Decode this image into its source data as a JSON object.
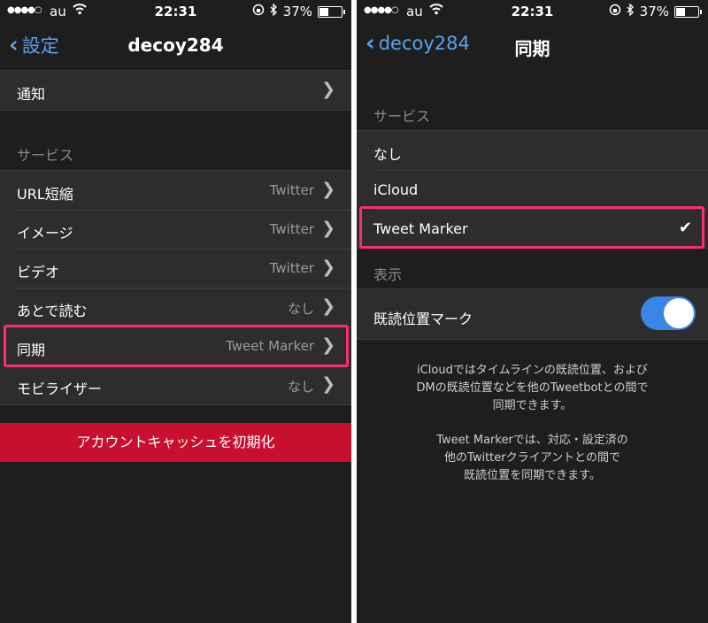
{
  "status": {
    "signal": "●●●●○",
    "carrier": "au",
    "time": "22:31",
    "battery": "37%",
    "battery_level": 0.37
  },
  "left": {
    "nav": {
      "back": "設定",
      "title": "decoy284"
    },
    "notifications": {
      "label": "通知"
    },
    "services_header": "サービス",
    "services": [
      {
        "label": "URL短縮",
        "value": "Twitter"
      },
      {
        "label": "イメージ",
        "value": "Twitter"
      },
      {
        "label": "ビデオ",
        "value": "Twitter"
      },
      {
        "label": "あとで読む",
        "value": "なし"
      },
      {
        "label": "同期",
        "value": "Tweet Marker"
      },
      {
        "label": "モビライザー",
        "value": "なし"
      }
    ],
    "reset_button": "アカウントキャッシュを初期化"
  },
  "right": {
    "nav": {
      "back": "decoy284",
      "title": "同期"
    },
    "services_header": "サービス",
    "options": [
      {
        "label": "なし"
      },
      {
        "label": "iCloud"
      },
      {
        "label": "Tweet Marker",
        "selected": true
      }
    ],
    "display_header": "表示",
    "toggle": {
      "label": "既読位置マーク",
      "on": true
    },
    "footer1": [
      "iCloudではタイムラインの既読位置、および",
      "DMの既読位置などを他のTweetbotとの間で",
      "同期できます。"
    ],
    "footer2": [
      "Tweet Markerでは、対応・設定済の",
      "他のTwitterクライアントとの間で",
      "既読位置を同期できます。"
    ]
  },
  "colors": {
    "accent_blue": "#58a3f0",
    "highlight_pink": "#ff2d6f",
    "danger_red": "#c8102e",
    "toggle_on": "#3a86e8"
  }
}
